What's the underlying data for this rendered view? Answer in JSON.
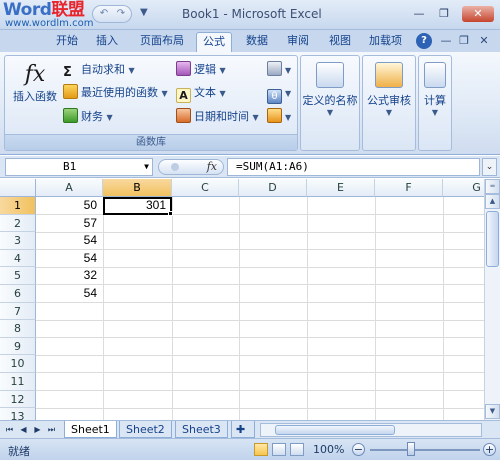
{
  "titlebar": {
    "logo_main": "Word",
    "logo_accent": "联盟",
    "logo_url": "www.wordlm.com",
    "title": "Book1 - Microsoft Excel",
    "minimize": "—",
    "restore": "❐",
    "close": "✕"
  },
  "tabs": [
    {
      "label": "开始"
    },
    {
      "label": "插入"
    },
    {
      "label": "页面布局"
    },
    {
      "label": "公式"
    },
    {
      "label": "数据"
    },
    {
      "label": "审阅"
    },
    {
      "label": "视图"
    },
    {
      "label": "加载项"
    }
  ],
  "active_tab": "公式",
  "ribbon": {
    "function_library": {
      "label": "函数库",
      "insert_function": "插入函数",
      "autosum": "自动求和",
      "recent": "最近使用的函数",
      "financial": "财务",
      "logical": "逻辑",
      "text": "文本",
      "datetime": "日期和时间"
    },
    "defined_names": "定义的名称",
    "formula_auditing": "公式审核",
    "calculation": "计算"
  },
  "formula_bar": {
    "name_box": "B1",
    "fx": "fx",
    "formula": "=SUM(A1:A6)"
  },
  "sheet": {
    "columns": [
      "A",
      "B",
      "C",
      "D",
      "E",
      "F",
      "G"
    ],
    "rows": [
      "1",
      "2",
      "3",
      "4",
      "5",
      "6",
      "7",
      "8",
      "9",
      "10",
      "11",
      "12",
      "13"
    ],
    "selected_cell": "B1",
    "col_a_values": [
      "50",
      "57",
      "54",
      "54",
      "32",
      "54"
    ],
    "b1_value": "301"
  },
  "sheet_tabs": [
    "Sheet1",
    "Sheet2",
    "Sheet3"
  ],
  "active_sheet": "Sheet1",
  "status": {
    "ready": "就绪",
    "zoom": "100%",
    "zoom_out": "−",
    "zoom_in": "+"
  },
  "colors": {
    "accent": "#15428b",
    "selected_header": "#f1c15f",
    "ribbon_bg": "#dfe9f6"
  },
  "icons": {
    "insert_function": "fx-icon",
    "autosum": "sigma-icon",
    "recent": "star-icon",
    "financial": "coins-icon",
    "logical": "question-book-icon",
    "text": "letter-a-icon",
    "datetime": "calendar-icon"
  }
}
